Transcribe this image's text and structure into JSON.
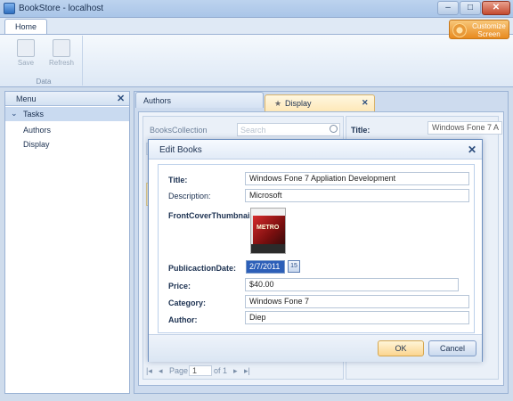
{
  "window": {
    "title": "BookStore - localhost",
    "minimize": "–",
    "maximize": "□",
    "close": "✕"
  },
  "ribbon": {
    "tab_home": "Home",
    "group_data": "Data",
    "save_label": "Save",
    "refresh_label": "Refresh",
    "customize_label": "Customize Screen"
  },
  "menu": {
    "title": "Menu",
    "close_icon": "✕",
    "tasks_label": "Tasks",
    "items": [
      "Authors",
      "Display"
    ]
  },
  "tabs": {
    "authors": "Authors",
    "display": "Display",
    "display_star": "★",
    "display_close": "✕"
  },
  "collection": {
    "title": "BooksCollection",
    "search_placeholder": "Search",
    "page_label": "Page",
    "page_value": "1",
    "of_label": "of 1"
  },
  "detail": {
    "title_label": "Title:",
    "title_value": "Windows Fone 7 A"
  },
  "dialog": {
    "title": "Edit Books",
    "close_icon": "✕",
    "fields": {
      "title_label": "Title:",
      "title_value": "Windows Fone 7 Appliation Development",
      "description_label": "Description:",
      "description_value": "Microsoft",
      "thumbnail_label": "FrontCoverThumbnail:",
      "pubdate_label": "PublicactionDate:",
      "pubdate_value": "2/7/2011",
      "pubdate_icon": "15",
      "price_label": "Price:",
      "price_value": "$40.00",
      "category_label": "Category:",
      "category_value": "Windows Fone 7",
      "author_label": "Author:",
      "author_value": "Diep"
    },
    "ok_label": "OK",
    "cancel_label": "Cancel"
  }
}
